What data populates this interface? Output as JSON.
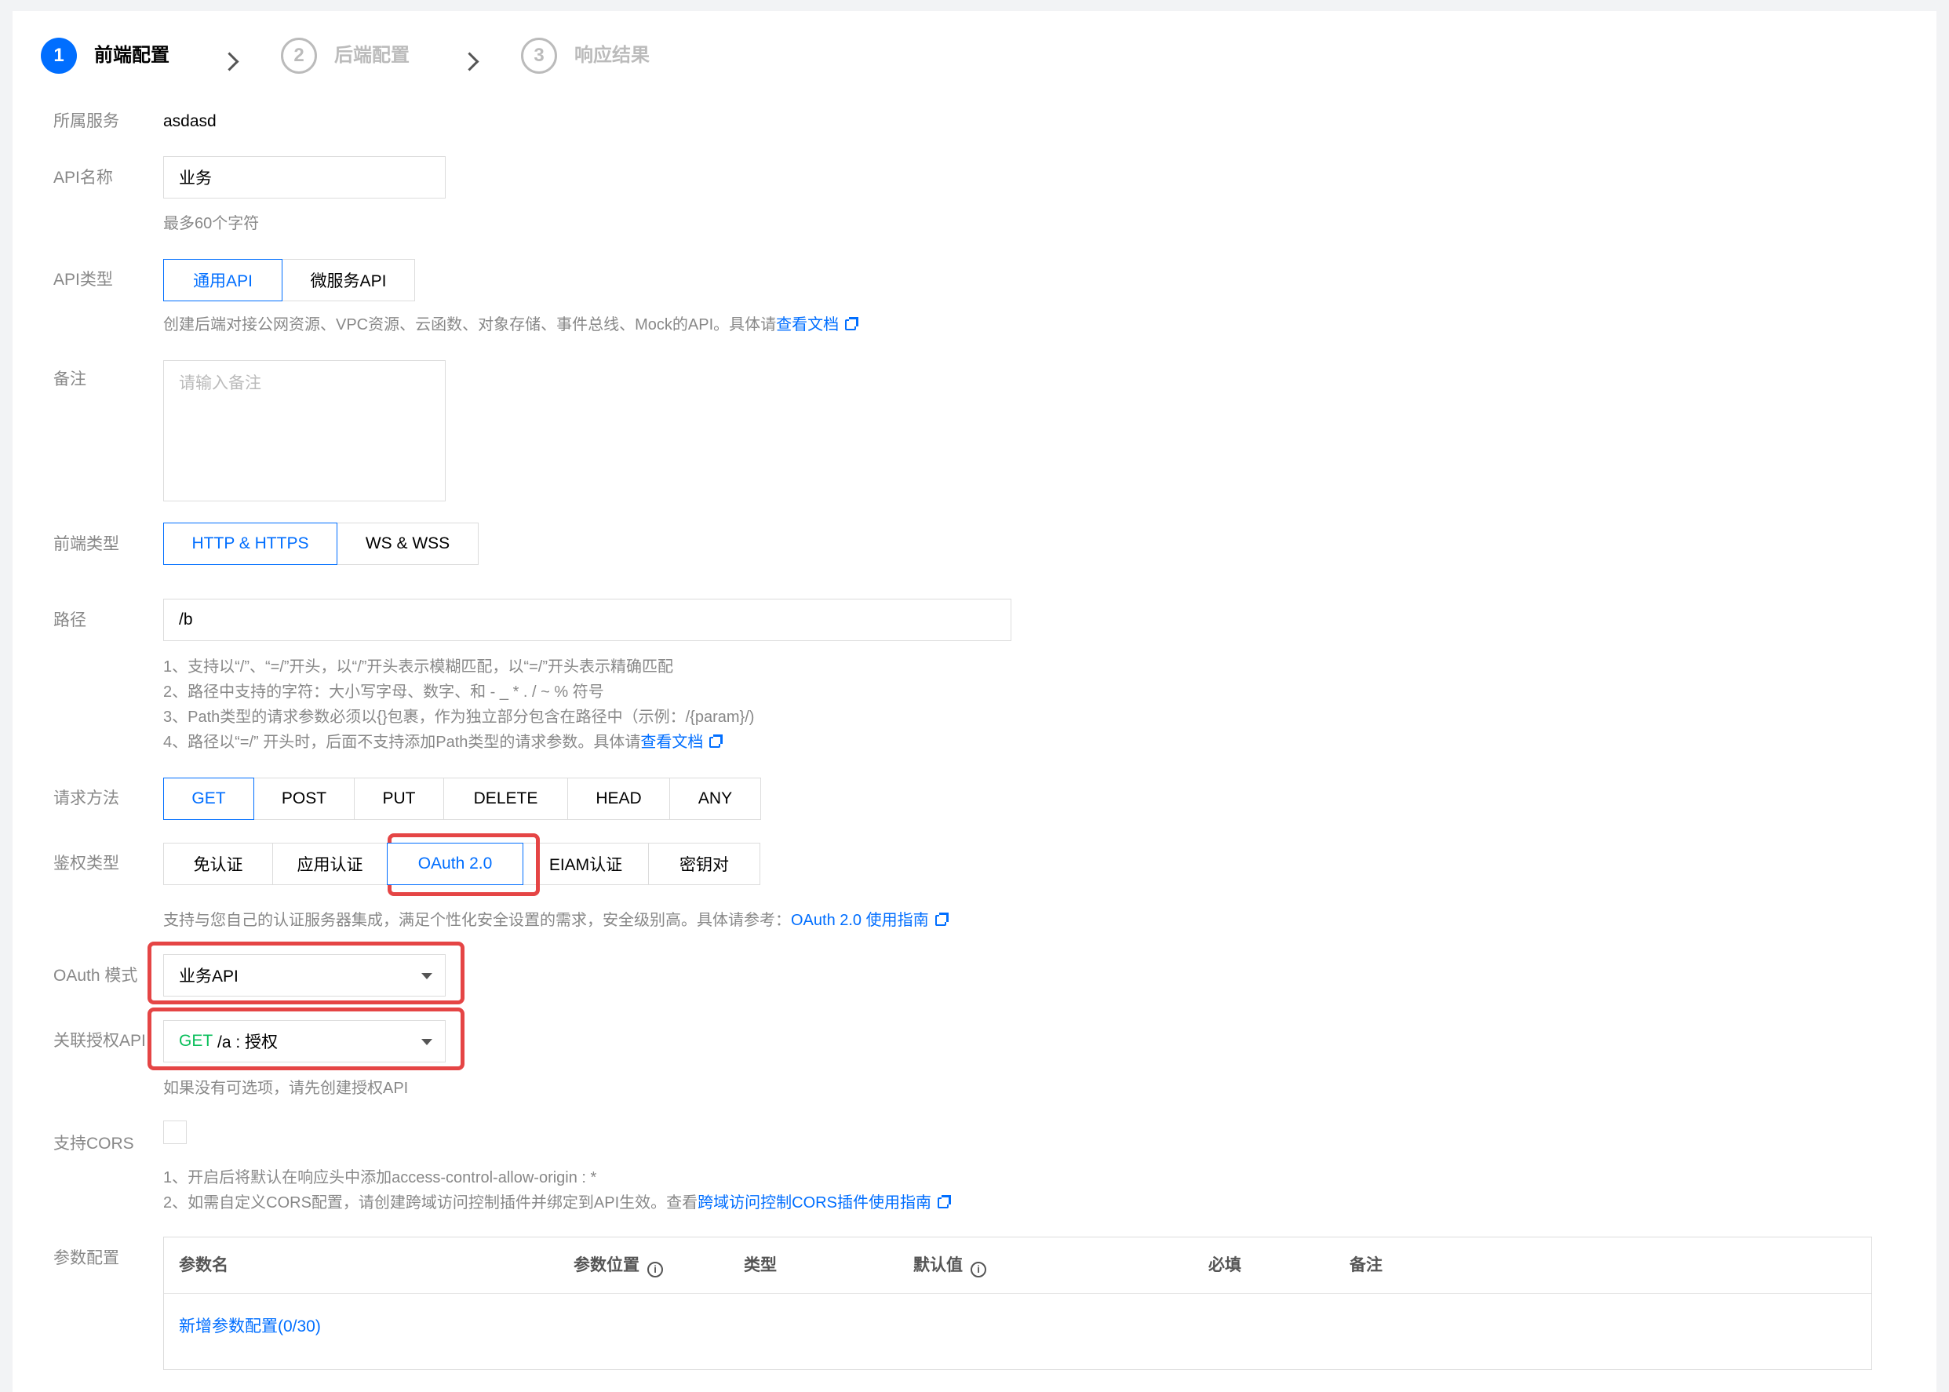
{
  "steps": [
    {
      "num": "1",
      "label": "前端配置"
    },
    {
      "num": "2",
      "label": "后端配置"
    },
    {
      "num": "3",
      "label": "响应结果"
    }
  ],
  "service": {
    "label": "所属服务",
    "value": "asdasd"
  },
  "api_name": {
    "label": "API名称",
    "value": "业务",
    "hint": "最多60个字符"
  },
  "api_type": {
    "label": "API类型",
    "options": [
      "通用API",
      "微服务API"
    ],
    "selected": "通用API",
    "hint_prefix": "创建后端对接公网资源、VPC资源、云函数、对象存储、事件总线、Mock的API。具体请",
    "hint_link": "查看文档"
  },
  "remark": {
    "label": "备注",
    "placeholder": "请输入备注"
  },
  "frontend_type": {
    "label": "前端类型",
    "options": [
      "HTTP & HTTPS",
      "WS & WSS"
    ],
    "selected": "HTTP & HTTPS"
  },
  "path": {
    "label": "路径",
    "value": "/b",
    "hints": [
      "1、支持以“/”、“=/”开头，以“/”开头表示模糊匹配，以“=/”开头表示精确匹配",
      "2、路径中支持的字符：大小写字母、数字、和 - _ * . / ~ % 符号",
      "3、Path类型的请求参数必须以{}包裹，作为独立部分包含在路径中（示例：/{param}/)"
    ],
    "hint4_prefix": "4、路径以“=/” 开头时，后面不支持添加Path类型的请求参数。具体请",
    "hint4_link": "查看文档"
  },
  "method": {
    "label": "请求方法",
    "options": [
      "GET",
      "POST",
      "PUT",
      "DELETE",
      "HEAD",
      "ANY"
    ],
    "selected": "GET"
  },
  "auth": {
    "label": "鉴权类型",
    "options": [
      "免认证",
      "应用认证",
      "OAuth 2.0",
      "EIAM认证",
      "密钥对"
    ],
    "selected": "OAuth 2.0",
    "hint_prefix": "支持与您自己的认证服务器集成，满足个性化安全设置的需求，安全级别高。具体请参考：",
    "hint_link": "OAuth 2.0 使用指南"
  },
  "oauth_mode": {
    "label": "OAuth 模式",
    "value": "业务API"
  },
  "linked_api": {
    "label": "关联授权API",
    "method": "GET",
    "value": " /a : 授权",
    "hint": "如果没有可选项，请先创建授权API"
  },
  "cors": {
    "label": "支持CORS",
    "hint1": "1、开启后将默认在响应头中添加access-control-allow-origin : *",
    "hint2_prefix": "2、如需自定义CORS配置，请创建跨域访问控制插件并绑定到API生效。查看",
    "hint2_link": "跨域访问控制CORS插件使用指南"
  },
  "params": {
    "label": "参数配置",
    "columns": [
      "参数名",
      "参数位置",
      "类型",
      "默认值",
      "必填",
      "备注"
    ],
    "add_link": "新增参数配置(0/30)"
  },
  "colors": {
    "accent": "#006eff",
    "highlight": "#e54545",
    "method_get": "#0abf5b"
  }
}
